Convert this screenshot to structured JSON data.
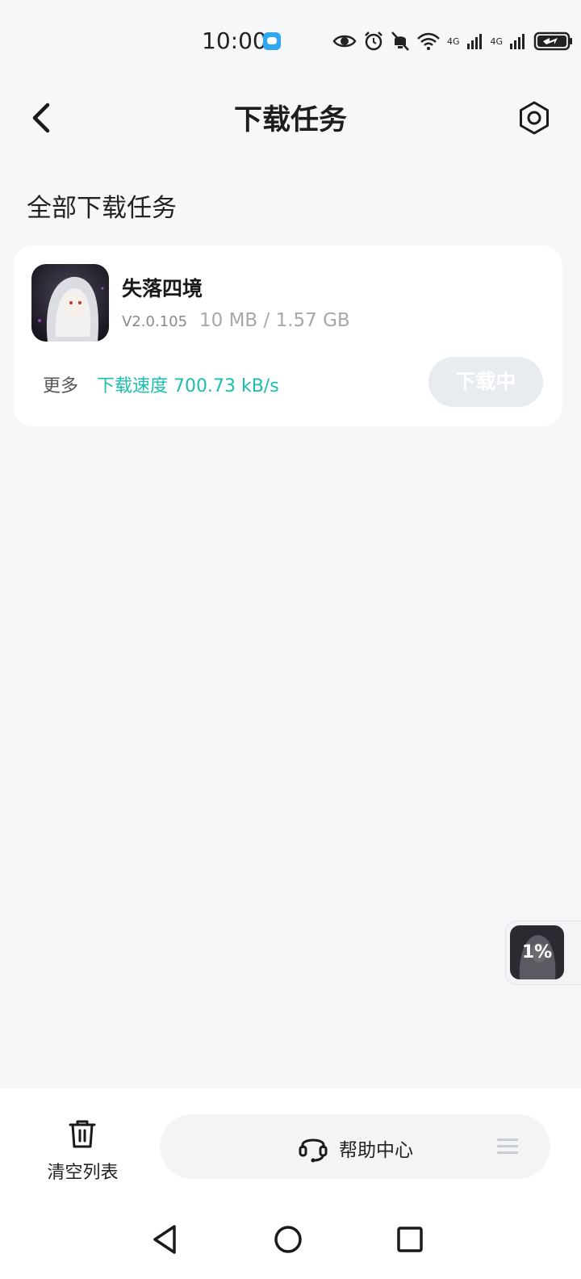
{
  "status_bar": {
    "time": "10:00",
    "network_1": "4G",
    "network_2": "4G",
    "icons": [
      "message-icon",
      "eye-icon",
      "alarm-icon",
      "bell-off-icon",
      "wifi-icon",
      "signal-icon",
      "signal-icon",
      "battery-charging-icon"
    ]
  },
  "header": {
    "title": "下载任务",
    "back_icon": "chevron-left-icon",
    "settings_icon": "gear-icon"
  },
  "section": {
    "title": "全部下载任务"
  },
  "task": {
    "name": "失落四境",
    "version": "V2.0.105",
    "size": "10 MB / 1.57 GB",
    "more_label": "更多",
    "speed": "下载速度 700.73 kB/s",
    "status_button": "下载中",
    "accent_color": "#1bbfae"
  },
  "floating_widget": {
    "progress": "1%"
  },
  "bottom_bar": {
    "clear_label": "清空列表",
    "help_label": "帮助中心",
    "icons": [
      "trash-icon",
      "headset-icon",
      "menu-icon"
    ]
  },
  "system_nav": {
    "icons": [
      "back-triangle-icon",
      "home-circle-icon",
      "recents-square-icon"
    ]
  }
}
